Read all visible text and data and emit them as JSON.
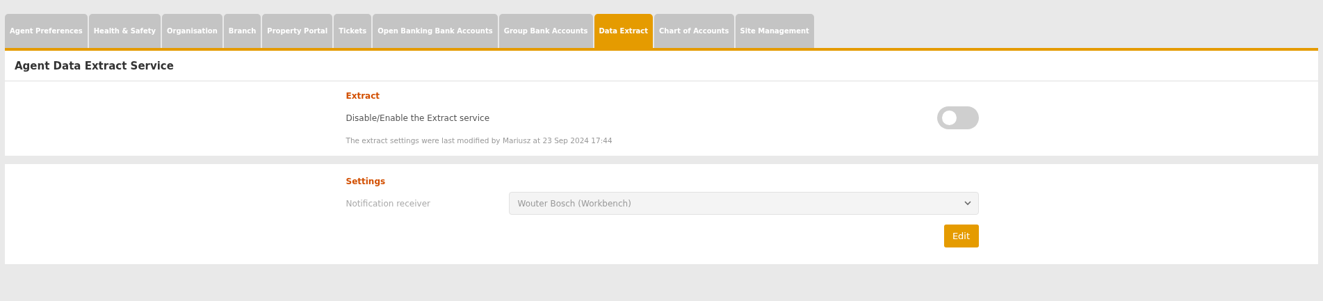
{
  "tabs": [
    {
      "label": "Agent Preferences",
      "selected": false
    },
    {
      "label": "Health & Safety",
      "selected": false
    },
    {
      "label": "Organisation",
      "selected": false
    },
    {
      "label": "Branch",
      "selected": false
    },
    {
      "label": "Property Portal",
      "selected": false
    },
    {
      "label": "Tickets",
      "selected": false
    },
    {
      "label": "Open Banking Bank Accounts",
      "selected": false
    },
    {
      "label": "Group Bank Accounts",
      "selected": false
    },
    {
      "label": "Data Extract",
      "selected": true
    },
    {
      "label": "Chart of Accounts",
      "selected": false
    },
    {
      "label": "Site Management",
      "selected": false
    }
  ],
  "page_title": "Agent Data Extract Service",
  "extract": {
    "heading": "Extract",
    "toggle_label": "Disable/Enable the Extract service",
    "on": false,
    "note": "The extract settings were last modified by Mariusz at 23 Sep 2024 17:44"
  },
  "settings": {
    "heading": "Settings",
    "field_label": "Notification receiver",
    "value": "Wouter Bosch (Workbench)",
    "disabled": true,
    "button": "Edit"
  }
}
